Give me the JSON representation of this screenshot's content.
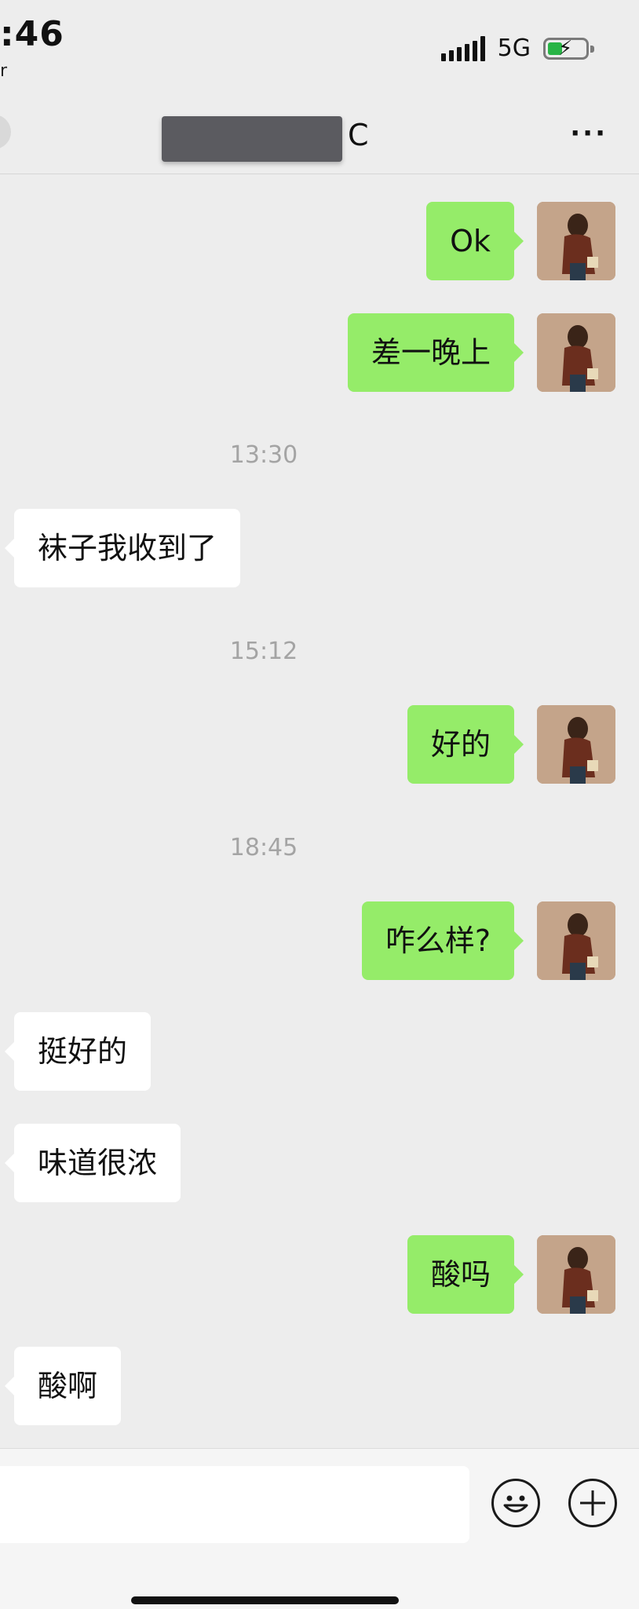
{
  "status_bar": {
    "time": ":46",
    "sub": "r",
    "network": "5G",
    "signal_icon": "signal-bars-icon",
    "battery_icon": "battery-charging-icon"
  },
  "header": {
    "title_suffix": "C",
    "back_icon": "back-button",
    "more_icon": "more-dots-icon",
    "more_label": "···"
  },
  "messages": [
    {
      "side": "out",
      "text": "Ok"
    },
    {
      "side": "out",
      "text": "差一晚上"
    },
    {
      "type": "time",
      "text": "13:30"
    },
    {
      "side": "in",
      "text": "袜子我收到了"
    },
    {
      "type": "time",
      "text": "15:12"
    },
    {
      "side": "out",
      "text": "好的"
    },
    {
      "type": "time",
      "text": "18:45"
    },
    {
      "side": "out",
      "text": "咋么样?"
    },
    {
      "side": "in",
      "text": "挺好的"
    },
    {
      "side": "in",
      "text": "味道很浓"
    },
    {
      "side": "out",
      "text": "酸吗"
    },
    {
      "side": "in",
      "text": "酸啊"
    }
  ],
  "input_bar": {
    "emoji_icon": "emoji-icon",
    "plus_icon": "plus-icon"
  },
  "colors": {
    "outgoing_bubble": "#95ec69",
    "incoming_bubble": "#ffffff",
    "background": "#ededed",
    "timestamp": "#a4a4a4"
  }
}
